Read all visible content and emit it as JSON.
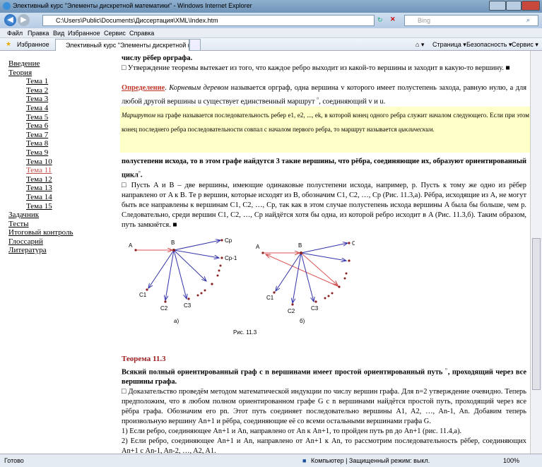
{
  "window": {
    "title": "Элективный курс \"Элементы дискретной математики\" - Windows Internet Explorer"
  },
  "address": {
    "url": "C:\\Users\\Public\\Documents\\Диссертация\\XML\\Index.htm",
    "search_placeholder": "Bing"
  },
  "menu": [
    "Файл",
    "Правка",
    "Вид",
    "Избранное",
    "Сервис",
    "Справка"
  ],
  "favbar": {
    "favorites": "Избранное",
    "tab": "Элективный курс \"Элементы дискретной мате...",
    "page": "Страница ▾",
    "safety": "Безопасность ▾",
    "tools": "Сервис ▾"
  },
  "sidebar": {
    "intro": "Введение",
    "theory": "Теория",
    "topics": [
      "Тема 1",
      "Тема 2",
      "Тема 3",
      "Тема 4",
      "Тема 5",
      "Тема 6",
      "Тема 7",
      "Тема 8",
      "Тема 9",
      "Тема 10",
      "Тема 11",
      "Тема 12",
      "Тема 13",
      "Тема 14",
      "Тема 15"
    ],
    "tasks": "Задачник",
    "tests": "Тесты",
    "final": "Итоговый контроль",
    "glossary": "Глоссарий",
    "literature": "Литература"
  },
  "main": {
    "p0": "числу рёбер орграфа.",
    "p1": "□ Утверждение теоремы вытекает из того, что каждое ребро выходит из какой-то вершины и заходит в какую-то вершину. ■",
    "def_label": "Определение",
    "def_term": "Корневым деревом",
    "def_text": " называется орграф, одна вершина v которого имеет полустепень захода, равную нулю, а для любой другой вершины u существует единственный маршрут ",
    "def_end": ", соединяющий v и u.",
    "tooltip_term": "Маршрутом",
    "tooltip_text": " на графе называется последовательность ребер e1, e2, ..., ek, в которой конец одного ребра служит началом следующего. Если при этом конец последнего ребра последовательности совпал с началом первого ребра, то маршрут называется ",
    "tooltip_term2": "циклическим.",
    "p2": "полустепени исхода, то в этом графе найдутся 3 такие вершины, что рёбра, соединяющие их, образуют ориентированный цикл",
    "p3": "□ Пусть A и B – две вершины, имеющие одинаковые полустепени исхода, например, p. Пусть к тому же одно из рёбер направлено от A к B. Те p вершин, которые исходят из B, обозначим C1, C2, …, Cp (Рис. 11.3,а). Рёбра, исходящие из A, не могут быть все направлены к вершинам C1, C2, …, Cp, так как в этом случае полустепень исхода вершины A была бы больше, чем p. Следовательно, среди вершин C1, C2, …, Cp найдётся хотя бы одна, из которой ребро исходит в A (Рис. 11.3,б). Таким образом, путь замкнётся. ■",
    "fig": {
      "A": "A",
      "B": "B",
      "Cp": "Cp",
      "Cp1": "Cp-1",
      "C1": "C1",
      "C2": "C2",
      "C3": "C3",
      "a": "а)",
      "b": "б)",
      "caption": "Рис. 11.3"
    },
    "theorem_title": "Теорема 11.3",
    "theorem_text": "Всякий полный ориентированный граф с n вершинами имеет простой ориентированный путь",
    "theorem_text2": ", проходящий через все вершины графа.",
    "p4": "□ Доказательство проведём методом математической индукции по числу вершин графа. Для n=2 утверждение очевидно. Теперь предположим, что в любом полном ориентированном графе G с n вершинами найдётся простой путь, проходящий через все рёбра графа. Обозначим его pn. Этот путь соединяет последовательно вершины A1, A2, …, An-1, An. Добавим теперь произвольную вершину An+1 и рёбра, соединяющие её со всеми остальными вершинами графа G.",
    "p5": "1) Если ребро, соединяющее An+1 и An, направлено от An к An+1, то пройден путь pn до An+1 (рис. 11.4,а).",
    "p6": "2) Если ребро, соединяющее An+1 и An, направлено от An+1 к An, то рассмотрим последовательность рёбер, соединяющих An+1 с An-1, An-2, …, A2, A1."
  },
  "status": {
    "left": "Готово",
    "zone": "Компьютер | Защищенный режим: выкл.",
    "zoom": "100%"
  }
}
